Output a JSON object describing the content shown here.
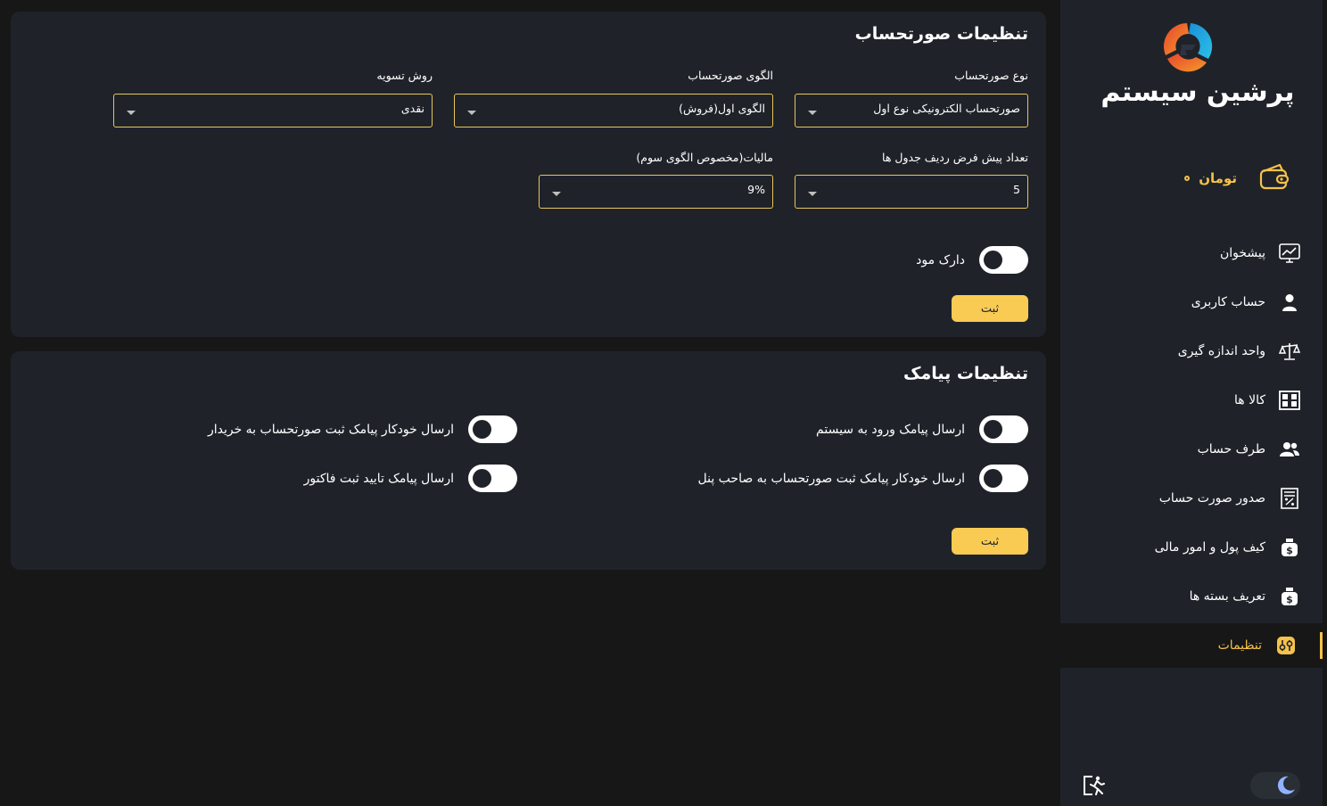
{
  "sidebar": {
    "brand": "پرشین سیستم",
    "currency": "تومان",
    "items": [
      {
        "label": "پیشخوان",
        "icon": "dashboard-chart-icon"
      },
      {
        "label": "حساب کاربری",
        "icon": "user-icon"
      },
      {
        "label": "واحد اندازه گیری",
        "icon": "scale-icon"
      },
      {
        "label": "کالا ها",
        "icon": "warehouse-icon"
      },
      {
        "label": "طرف حساب",
        "icon": "users-icon"
      },
      {
        "label": "صدور صورت حساب",
        "icon": "invoice-icon"
      },
      {
        "label": "کیف پول و امور مالی",
        "icon": "money-bag-icon"
      },
      {
        "label": "تعریف بسته ها",
        "icon": "money-bag-icon"
      },
      {
        "label": "تنظیمات",
        "icon": "settings-sliders-icon",
        "active": true
      }
    ]
  },
  "invoice_settings": {
    "title": "تنظیمات صورتحساب",
    "invoice_type": {
      "label": "نوع صورتحساب",
      "value": "صورتحساب الکترونیکی نوع اول"
    },
    "invoice_pattern": {
      "label": "الگوی صورتحساب",
      "value": "الگوی اول(فروش)"
    },
    "settlement_method": {
      "label": "روش تسویه",
      "value": "نقدی"
    },
    "default_rows": {
      "label": "تعداد پیش فرض ردیف جدول ها",
      "value": "5"
    },
    "tax": {
      "label": "مالیات(مخصوص الگوی سوم)",
      "value": "9%"
    },
    "dark_mode": {
      "label": "دارک مود",
      "on": false
    },
    "save_label": "ثبت"
  },
  "sms_settings": {
    "title": "تنظیمات پیامک",
    "login_sms": {
      "label": "ارسال پیامک ورود به سیستم",
      "on": false
    },
    "buyer_auto_sms": {
      "label": "ارسال خودکار پیامک ثبت صورتحساب به خریدار",
      "on": false
    },
    "panel_owner_auto_sms": {
      "label": "ارسال خودکار پیامک ثبت صورتحساب به صاحب پنل",
      "on": false
    },
    "invoice_confirm_sms": {
      "label": "ارسال پیامک تایید ثبت فاکتور",
      "on": false
    },
    "save_label": "ثبت"
  },
  "colors": {
    "accent": "#f5c24a",
    "button": "#f9cb53",
    "panel": "#1f2329",
    "background": "#171717",
    "border": "#e8c55a"
  }
}
